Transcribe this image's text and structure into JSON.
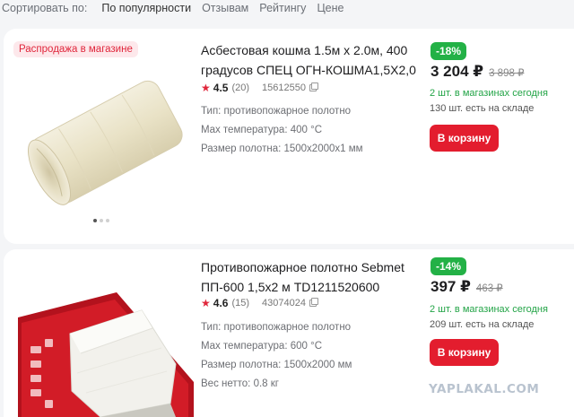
{
  "sort": {
    "label": "Сортировать по:",
    "options": [
      "По популярности",
      "Отзывам",
      "Рейтингу",
      "Цене"
    ]
  },
  "products": [
    {
      "badge": "Распродажа в магазине",
      "title": "Асбестовая кошма 1.5м х 2.0м, 400 градусов СПЕЦ ОГН-КОШМА1,5Х2,0",
      "rating": "4.5",
      "reviews": "(20)",
      "sku": "15612550",
      "specs": [
        "Тип: противопожарное полотно",
        "Max температура: 400 °C",
        "Размер полотна: 1500x2000x1 мм"
      ],
      "discount": "-18%",
      "price": "3 204 ₽",
      "old_price": "3 898 ₽",
      "availability_stores": "2 шт. в магазинах сегодня",
      "availability_warehouse": "130 шт. есть на складе",
      "cart_label": "В корзину"
    },
    {
      "title": "Противопожарное полотно Sebmet ПП-600 1,5х2 м TD1211520600",
      "rating": "4.6",
      "reviews": "(15)",
      "sku": "43074024",
      "specs": [
        "Тип: противопожарное полотно",
        "Max температура: 600 °C",
        "Размер полотна: 1500x2000 мм",
        "Вес нетто: 0.8 кг"
      ],
      "discount": "-14%",
      "price": "397 ₽",
      "old_price": "463 ₽",
      "availability_stores": "2 шт. в магазинах сегодня",
      "availability_warehouse": "209 шт. есть на складе",
      "cart_label": "В корзину"
    }
  ],
  "watermark": "YAPLAKAL.COM",
  "colors": {
    "accent_red": "#e31d2e",
    "discount_green": "#23b146",
    "stock_green": "#23a447",
    "sale_badge_bg": "#fde8eb"
  }
}
